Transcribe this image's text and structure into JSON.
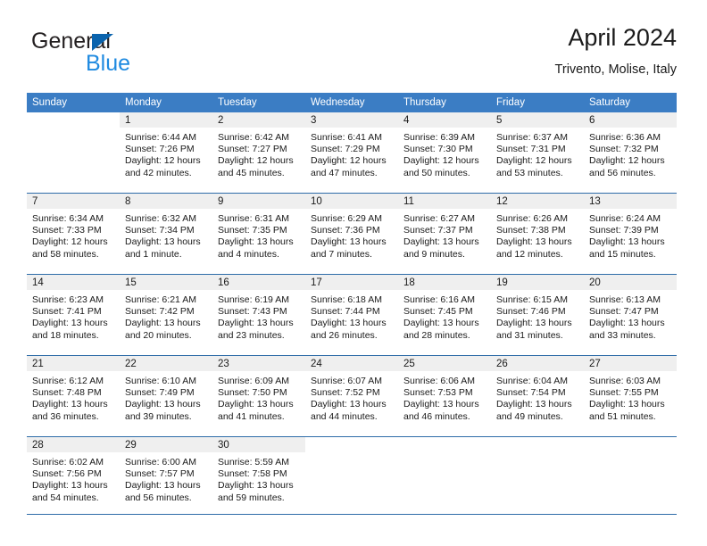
{
  "brand": {
    "name_part1": "General",
    "name_part2": "Blue",
    "triangle_icon": "triangle-icon",
    "color_dark": "#231f20",
    "color_blue": "#1f8ae0",
    "color_triangle": "#0a63ad"
  },
  "header": {
    "month_title": "April 2024",
    "location": "Trivento, Molise, Italy"
  },
  "theme": {
    "header_row_bg": "#3b7dc4",
    "row_divider": "#2e6ca8",
    "daynum_band_bg": "#efefef",
    "text": "#1a1a1a"
  },
  "weekdays": [
    "Sunday",
    "Monday",
    "Tuesday",
    "Wednesday",
    "Thursday",
    "Friday",
    "Saturday"
  ],
  "weeks": [
    [
      {
        "day": "",
        "sunrise": "",
        "sunset": "",
        "daylight_line1": "",
        "daylight_line2": "",
        "blank": true
      },
      {
        "day": "1",
        "sunrise": "Sunrise: 6:44 AM",
        "sunset": "Sunset: 7:26 PM",
        "daylight_line1": "Daylight: 12 hours",
        "daylight_line2": "and 42 minutes."
      },
      {
        "day": "2",
        "sunrise": "Sunrise: 6:42 AM",
        "sunset": "Sunset: 7:27 PM",
        "daylight_line1": "Daylight: 12 hours",
        "daylight_line2": "and 45 minutes."
      },
      {
        "day": "3",
        "sunrise": "Sunrise: 6:41 AM",
        "sunset": "Sunset: 7:29 PM",
        "daylight_line1": "Daylight: 12 hours",
        "daylight_line2": "and 47 minutes."
      },
      {
        "day": "4",
        "sunrise": "Sunrise: 6:39 AM",
        "sunset": "Sunset: 7:30 PM",
        "daylight_line1": "Daylight: 12 hours",
        "daylight_line2": "and 50 minutes."
      },
      {
        "day": "5",
        "sunrise": "Sunrise: 6:37 AM",
        "sunset": "Sunset: 7:31 PM",
        "daylight_line1": "Daylight: 12 hours",
        "daylight_line2": "and 53 minutes."
      },
      {
        "day": "6",
        "sunrise": "Sunrise: 6:36 AM",
        "sunset": "Sunset: 7:32 PM",
        "daylight_line1": "Daylight: 12 hours",
        "daylight_line2": "and 56 minutes."
      }
    ],
    [
      {
        "day": "7",
        "sunrise": "Sunrise: 6:34 AM",
        "sunset": "Sunset: 7:33 PM",
        "daylight_line1": "Daylight: 12 hours",
        "daylight_line2": "and 58 minutes."
      },
      {
        "day": "8",
        "sunrise": "Sunrise: 6:32 AM",
        "sunset": "Sunset: 7:34 PM",
        "daylight_line1": "Daylight: 13 hours",
        "daylight_line2": "and 1 minute."
      },
      {
        "day": "9",
        "sunrise": "Sunrise: 6:31 AM",
        "sunset": "Sunset: 7:35 PM",
        "daylight_line1": "Daylight: 13 hours",
        "daylight_line2": "and 4 minutes."
      },
      {
        "day": "10",
        "sunrise": "Sunrise: 6:29 AM",
        "sunset": "Sunset: 7:36 PM",
        "daylight_line1": "Daylight: 13 hours",
        "daylight_line2": "and 7 minutes."
      },
      {
        "day": "11",
        "sunrise": "Sunrise: 6:27 AM",
        "sunset": "Sunset: 7:37 PM",
        "daylight_line1": "Daylight: 13 hours",
        "daylight_line2": "and 9 minutes."
      },
      {
        "day": "12",
        "sunrise": "Sunrise: 6:26 AM",
        "sunset": "Sunset: 7:38 PM",
        "daylight_line1": "Daylight: 13 hours",
        "daylight_line2": "and 12 minutes."
      },
      {
        "day": "13",
        "sunrise": "Sunrise: 6:24 AM",
        "sunset": "Sunset: 7:39 PM",
        "daylight_line1": "Daylight: 13 hours",
        "daylight_line2": "and 15 minutes."
      }
    ],
    [
      {
        "day": "14",
        "sunrise": "Sunrise: 6:23 AM",
        "sunset": "Sunset: 7:41 PM",
        "daylight_line1": "Daylight: 13 hours",
        "daylight_line2": "and 18 minutes."
      },
      {
        "day": "15",
        "sunrise": "Sunrise: 6:21 AM",
        "sunset": "Sunset: 7:42 PM",
        "daylight_line1": "Daylight: 13 hours",
        "daylight_line2": "and 20 minutes."
      },
      {
        "day": "16",
        "sunrise": "Sunrise: 6:19 AM",
        "sunset": "Sunset: 7:43 PM",
        "daylight_line1": "Daylight: 13 hours",
        "daylight_line2": "and 23 minutes."
      },
      {
        "day": "17",
        "sunrise": "Sunrise: 6:18 AM",
        "sunset": "Sunset: 7:44 PM",
        "daylight_line1": "Daylight: 13 hours",
        "daylight_line2": "and 26 minutes."
      },
      {
        "day": "18",
        "sunrise": "Sunrise: 6:16 AM",
        "sunset": "Sunset: 7:45 PM",
        "daylight_line1": "Daylight: 13 hours",
        "daylight_line2": "and 28 minutes."
      },
      {
        "day": "19",
        "sunrise": "Sunrise: 6:15 AM",
        "sunset": "Sunset: 7:46 PM",
        "daylight_line1": "Daylight: 13 hours",
        "daylight_line2": "and 31 minutes."
      },
      {
        "day": "20",
        "sunrise": "Sunrise: 6:13 AM",
        "sunset": "Sunset: 7:47 PM",
        "daylight_line1": "Daylight: 13 hours",
        "daylight_line2": "and 33 minutes."
      }
    ],
    [
      {
        "day": "21",
        "sunrise": "Sunrise: 6:12 AM",
        "sunset": "Sunset: 7:48 PM",
        "daylight_line1": "Daylight: 13 hours",
        "daylight_line2": "and 36 minutes."
      },
      {
        "day": "22",
        "sunrise": "Sunrise: 6:10 AM",
        "sunset": "Sunset: 7:49 PM",
        "daylight_line1": "Daylight: 13 hours",
        "daylight_line2": "and 39 minutes."
      },
      {
        "day": "23",
        "sunrise": "Sunrise: 6:09 AM",
        "sunset": "Sunset: 7:50 PM",
        "daylight_line1": "Daylight: 13 hours",
        "daylight_line2": "and 41 minutes."
      },
      {
        "day": "24",
        "sunrise": "Sunrise: 6:07 AM",
        "sunset": "Sunset: 7:52 PM",
        "daylight_line1": "Daylight: 13 hours",
        "daylight_line2": "and 44 minutes."
      },
      {
        "day": "25",
        "sunrise": "Sunrise: 6:06 AM",
        "sunset": "Sunset: 7:53 PM",
        "daylight_line1": "Daylight: 13 hours",
        "daylight_line2": "and 46 minutes."
      },
      {
        "day": "26",
        "sunrise": "Sunrise: 6:04 AM",
        "sunset": "Sunset: 7:54 PM",
        "daylight_line1": "Daylight: 13 hours",
        "daylight_line2": "and 49 minutes."
      },
      {
        "day": "27",
        "sunrise": "Sunrise: 6:03 AM",
        "sunset": "Sunset: 7:55 PM",
        "daylight_line1": "Daylight: 13 hours",
        "daylight_line2": "and 51 minutes."
      }
    ],
    [
      {
        "day": "28",
        "sunrise": "Sunrise: 6:02 AM",
        "sunset": "Sunset: 7:56 PM",
        "daylight_line1": "Daylight: 13 hours",
        "daylight_line2": "and 54 minutes."
      },
      {
        "day": "29",
        "sunrise": "Sunrise: 6:00 AM",
        "sunset": "Sunset: 7:57 PM",
        "daylight_line1": "Daylight: 13 hours",
        "daylight_line2": "and 56 minutes."
      },
      {
        "day": "30",
        "sunrise": "Sunrise: 5:59 AM",
        "sunset": "Sunset: 7:58 PM",
        "daylight_line1": "Daylight: 13 hours",
        "daylight_line2": "and 59 minutes."
      },
      {
        "day": "",
        "sunrise": "",
        "sunset": "",
        "daylight_line1": "",
        "daylight_line2": "",
        "blank": true
      },
      {
        "day": "",
        "sunrise": "",
        "sunset": "",
        "daylight_line1": "",
        "daylight_line2": "",
        "blank": true
      },
      {
        "day": "",
        "sunrise": "",
        "sunset": "",
        "daylight_line1": "",
        "daylight_line2": "",
        "blank": true
      },
      {
        "day": "",
        "sunrise": "",
        "sunset": "",
        "daylight_line1": "",
        "daylight_line2": "",
        "blank": true
      }
    ]
  ]
}
